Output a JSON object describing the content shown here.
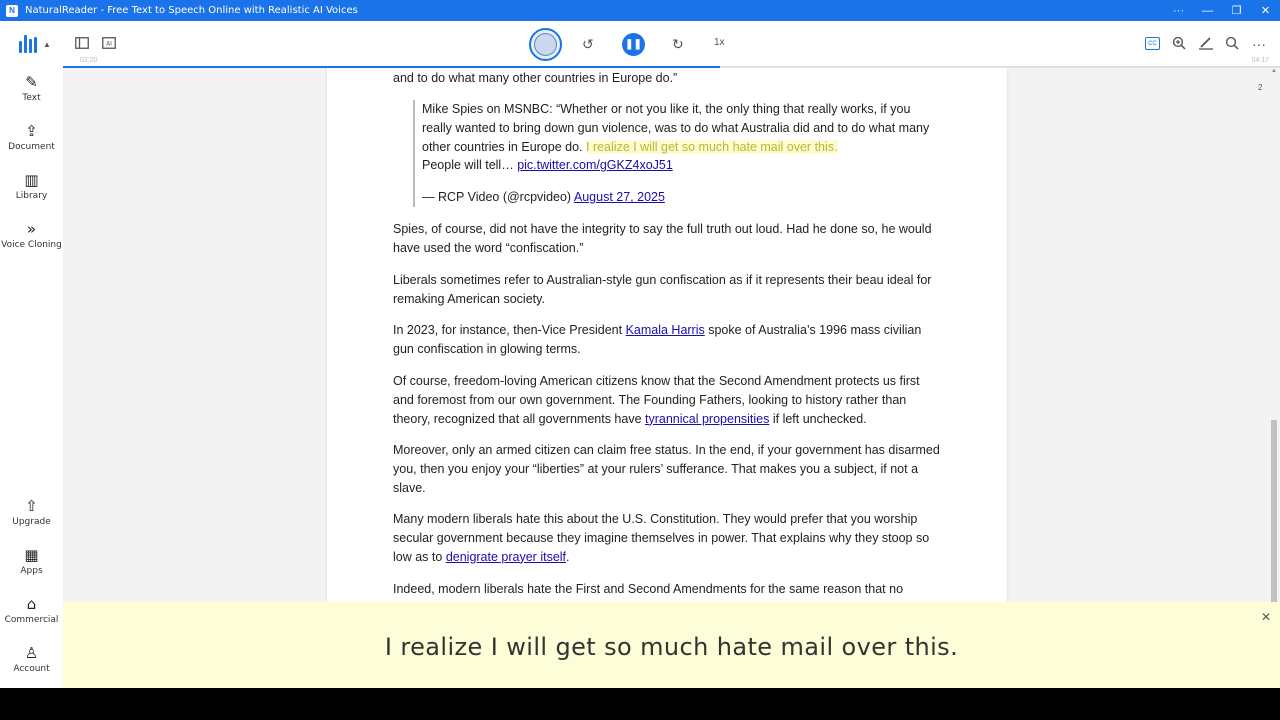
{
  "window": {
    "app_icon": "N",
    "title": "NaturalReader - Free Text to Speech Online with Realistic AI Voices",
    "controls": [
      "···",
      "—",
      "❐",
      "✕"
    ]
  },
  "sidebar": {
    "items": [
      {
        "id": "text",
        "label": "Text",
        "icon": "edit-icon",
        "glyph": "✎"
      },
      {
        "id": "document",
        "label": "Document",
        "icon": "upload-icon",
        "glyph": "⇪"
      },
      {
        "id": "library",
        "label": "Library",
        "icon": "library-icon",
        "glyph": "▥"
      },
      {
        "id": "voice-cloning",
        "label": "Voice Cloning",
        "icon": "voice-cloning-icon",
        "glyph": "»"
      },
      {
        "id": "upgrade",
        "label": "Upgrade",
        "icon": "upgrade-icon",
        "glyph": "⇧"
      },
      {
        "id": "apps",
        "label": "Apps",
        "icon": "apps-icon",
        "glyph": "▦"
      },
      {
        "id": "commercial",
        "label": "Commercial",
        "icon": "briefcase-icon",
        "glyph": "⌂"
      },
      {
        "id": "account",
        "label": "Account",
        "icon": "user-icon",
        "glyph": "♙"
      }
    ]
  },
  "toolbar": {
    "left_icons": [
      "sidebar-toggle-icon",
      "ai-icon"
    ],
    "ai_label": "AI",
    "rewind_glyph": "↺",
    "play_pause_glyph": "❚❚",
    "forward_glyph": "↻",
    "speed": "1x",
    "elapsed": "02:20",
    "duration": "04:17",
    "progress": 0.54,
    "cc_label": "CC",
    "right_icons": [
      "captions-icon",
      "zoom-in-icon",
      "highlighter-icon",
      "search-icon",
      "more-icon"
    ],
    "accent_color": "#1a73e8"
  },
  "document": {
    "page_number": "2",
    "p0": "and to do what many other countries in Europe do.”",
    "quote": {
      "text_before": "Mike Spies on MSNBC: “Whether or not you like it, the only thing that really works, if you really wanted to bring down gun violence, was to do what Australia did and to do what many other countries in Europe do. ",
      "highlight": "I realize I will get so much hate mail over this.",
      "text_after": "People will tell… ",
      "link": "pic.twitter.com/gGKZ4xoJ51",
      "attribution": "— RCP Video (@rcpvideo) ",
      "date_link": "August 27, 2025"
    },
    "p1": "Spies, of course, did not have the integrity to say the full truth out loud. Had he done so, he would have used the word “confiscation.”",
    "p2": "Liberals sometimes refer to Australian-style gun confiscation as if it represents their beau ideal for remaking American society.",
    "p3": {
      "before": "In 2023, for instance, then-Vice President ",
      "link": "Kamala Harris",
      "after": " spoke of Australia’s 1996 mass civilian gun confiscation in glowing terms."
    },
    "p4": {
      "before": "Of course, freedom-loving American citizens know that the Second Amendment protects us first and foremost from our own government. The Founding Fathers, looking to history rather than theory, recognized that all governments have ",
      "link": "tyrannical propensities",
      "after": " if left unchecked."
    },
    "p5": "Moreover, only an armed citizen can claim free status. In the end, if your government has disarmed you, then you enjoy your “liberties” at your rulers’ sufferance. That makes you a subject, if not a slave.",
    "p6": {
      "before": "Many modern liberals hate this about the U.S. Constitution. They would prefer that you worship secular government because they imagine themselves in power. That explains why they stoop so low as to ",
      "link": "denigrate prayer itself",
      "after": "."
    },
    "p7": "Indeed, modern liberals hate the First and Second Amendments for the same reason that no"
  },
  "caption": {
    "text": "I realize I will get so much hate mail over this.",
    "close_glyph": "✕",
    "background": "#fdfdd7"
  }
}
